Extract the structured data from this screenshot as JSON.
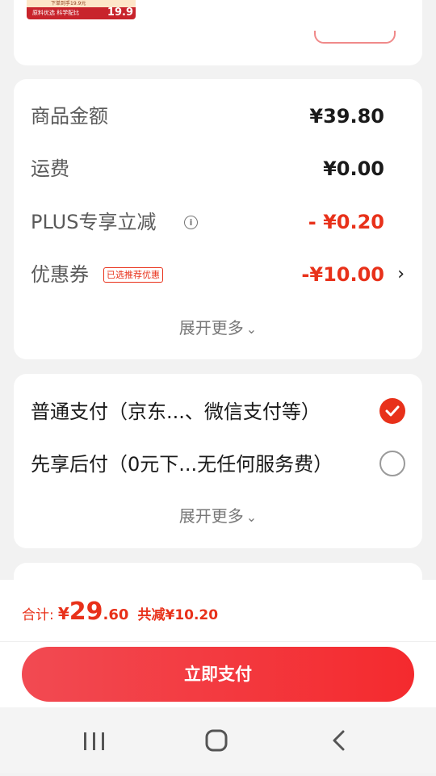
{
  "top": {
    "promo_line1": "下单到手19.9元",
    "promo_line2": "原料优选 科学配比",
    "promo_price": "19.9"
  },
  "price_summary": {
    "rows": [
      {
        "label": "商品金额",
        "value": "¥39.80"
      },
      {
        "label": "运费",
        "value": "¥0.00"
      },
      {
        "label": "PLUS专享立减",
        "value": "- ¥0.20"
      },
      {
        "label": "优惠券",
        "value": "-¥10.00",
        "tag": "已选推荐优惠"
      }
    ],
    "expand_label": "展开更多"
  },
  "payment": {
    "options": [
      {
        "label": "普通支付（京东...、微信支付等）",
        "selected": true
      },
      {
        "label": "先享后付（0元下...无任何服务费）",
        "selected": false
      }
    ],
    "expand_label": "展开更多"
  },
  "footer": {
    "total_label": "合计:",
    "currency": "¥",
    "total_int": "29",
    "total_dec": ".60",
    "saving_text": "共减¥10.20",
    "pay_button": "立即支付"
  },
  "colors": {
    "accent": "#e8311a",
    "button": "#f43a40"
  },
  "icons": [
    "info-icon",
    "chevron-right-icon",
    "chevron-down-icon",
    "check-icon",
    "recent-apps-icon",
    "home-icon",
    "back-icon"
  ]
}
